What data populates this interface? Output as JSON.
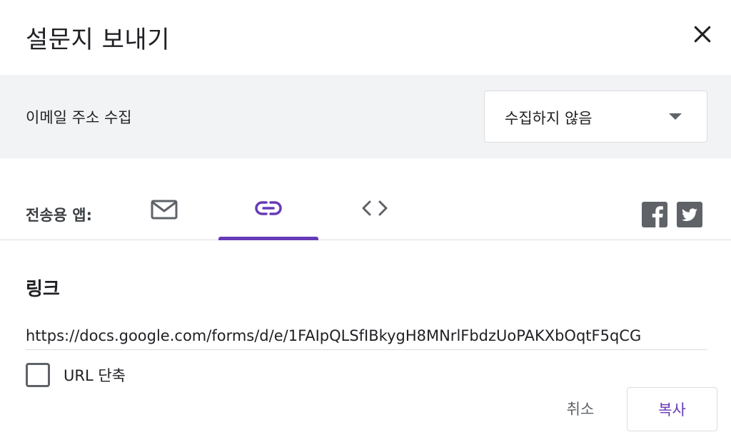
{
  "dialog": {
    "title": "설문지 보내기",
    "close_icon": "close-icon"
  },
  "email_collection": {
    "label": "이메일 주소 수집",
    "selected_option": "수집하지 않음",
    "arrow_icon": "dropdown-arrow-icon"
  },
  "send_via": {
    "label": "전송용 앱:",
    "tabs": [
      {
        "name": "email",
        "icon": "mail-icon",
        "active": false
      },
      {
        "name": "link",
        "icon": "link-icon",
        "active": true
      },
      {
        "name": "embed",
        "icon": "code-icon",
        "active": false
      }
    ],
    "social": [
      {
        "name": "facebook",
        "icon": "facebook-icon"
      },
      {
        "name": "twitter",
        "icon": "twitter-icon"
      }
    ]
  },
  "link": {
    "heading": "링크",
    "url": "https://docs.google.com/forms/d/e/1FAIpQLSfIBkygH8MNrlFbdzUoPAKXbOqtF5qCG",
    "shorten_label": "URL 단축",
    "shorten_checked": false
  },
  "actions": {
    "cancel_label": "취소",
    "copy_label": "복사"
  },
  "colors": {
    "accent": "#673ab7",
    "section_bg": "#f1f3f4",
    "icon_gray": "#5f6368"
  }
}
